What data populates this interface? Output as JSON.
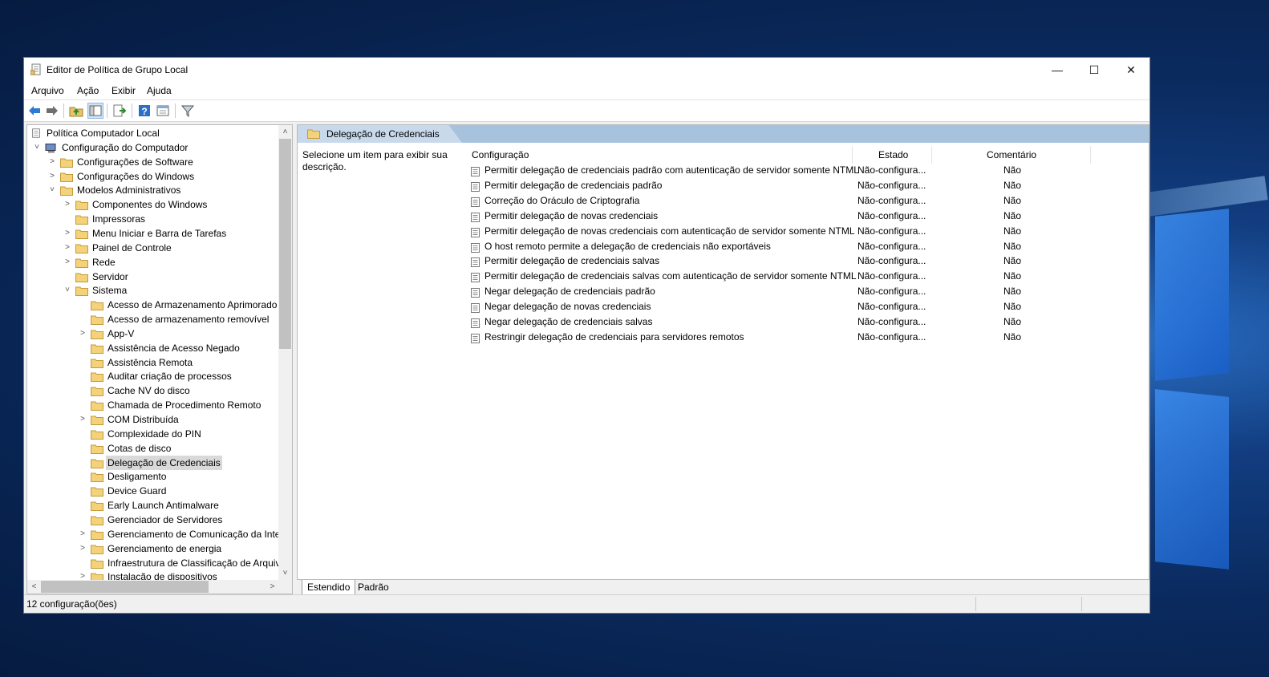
{
  "window": {
    "title": "Editor de Política de Grupo Local"
  },
  "menu": [
    "Arquivo",
    "Ação",
    "Exibir",
    "Ajuda"
  ],
  "toolbar_icons": [
    "back-arrow-icon",
    "forward-arrow-icon",
    "up-folder-icon",
    "show-hide-tree-icon",
    "export-list-icon",
    "help-icon",
    "properties-icon",
    "filter-icon"
  ],
  "tree": {
    "root": "Política Computador Local",
    "items": [
      {
        "label": "Configuração do Computador",
        "level": 1,
        "expander": "open",
        "icon": "computer"
      },
      {
        "label": "Configurações de Software",
        "level": 2,
        "expander": "closed"
      },
      {
        "label": "Configurações do Windows",
        "level": 2,
        "expander": "closed"
      },
      {
        "label": "Modelos Administrativos",
        "level": 2,
        "expander": "open"
      },
      {
        "label": "Componentes do Windows",
        "level": 3,
        "expander": "closed"
      },
      {
        "label": "Impressoras",
        "level": 3,
        "expander": "none"
      },
      {
        "label": "Menu Iniciar e Barra de Tarefas",
        "level": 3,
        "expander": "closed"
      },
      {
        "label": "Painel de Controle",
        "level": 3,
        "expander": "closed"
      },
      {
        "label": "Rede",
        "level": 3,
        "expander": "closed"
      },
      {
        "label": "Servidor",
        "level": 3,
        "expander": "none"
      },
      {
        "label": "Sistema",
        "level": 3,
        "expander": "open"
      },
      {
        "label": "Acesso de Armazenamento Aprimorado",
        "level": 4,
        "expander": "none"
      },
      {
        "label": "Acesso de armazenamento removível",
        "level": 4,
        "expander": "none"
      },
      {
        "label": "App-V",
        "level": 4,
        "expander": "closed"
      },
      {
        "label": "Assistência de Acesso Negado",
        "level": 4,
        "expander": "none"
      },
      {
        "label": "Assistência Remota",
        "level": 4,
        "expander": "none"
      },
      {
        "label": "Auditar criação de processos",
        "level": 4,
        "expander": "none"
      },
      {
        "label": "Cache NV do disco",
        "level": 4,
        "expander": "none"
      },
      {
        "label": "Chamada de Procedimento Remoto",
        "level": 4,
        "expander": "none"
      },
      {
        "label": "COM Distribuída",
        "level": 4,
        "expander": "closed"
      },
      {
        "label": "Complexidade do PIN",
        "level": 4,
        "expander": "none"
      },
      {
        "label": "Cotas de disco",
        "level": 4,
        "expander": "none"
      },
      {
        "label": "Delegação de Credenciais",
        "level": 4,
        "expander": "none",
        "selected": true
      },
      {
        "label": "Desligamento",
        "level": 4,
        "expander": "none"
      },
      {
        "label": "Device Guard",
        "level": 4,
        "expander": "none"
      },
      {
        "label": "Early Launch Antimalware",
        "level": 4,
        "expander": "none"
      },
      {
        "label": "Gerenciador de Servidores",
        "level": 4,
        "expander": "none"
      },
      {
        "label": "Gerenciamento de Comunicação da Internet",
        "level": 4,
        "expander": "closed"
      },
      {
        "label": "Gerenciamento de energia",
        "level": 4,
        "expander": "closed"
      },
      {
        "label": "Infraestrutura de Classificação de Arquivos",
        "level": 4,
        "expander": "none"
      },
      {
        "label": "Instalação de dispositivos",
        "level": 4,
        "expander": "closed"
      }
    ]
  },
  "right": {
    "header": "Delegação de Credenciais",
    "description": "Selecione um item para exibir sua descrição.",
    "columns": {
      "setting": "Configuração",
      "state": "Estado",
      "comment": "Comentário"
    },
    "rows": [
      {
        "name": "Permitir delegação de credenciais padrão com autenticação de servidor somente NTML",
        "state": "Não-configura...",
        "comment": "Não"
      },
      {
        "name": "Permitir delegação de credenciais padrão",
        "state": "Não-configura...",
        "comment": "Não"
      },
      {
        "name": "Correção do Oráculo de Criptografia",
        "state": "Não-configura...",
        "comment": "Não"
      },
      {
        "name": "Permitir delegação de novas credenciais",
        "state": "Não-configura...",
        "comment": "Não"
      },
      {
        "name": "Permitir delegação de novas credenciais com autenticação de servidor somente NTML",
        "state": "Não-configura...",
        "comment": "Não"
      },
      {
        "name": "O host remoto permite a delegação de credenciais não exportáveis",
        "state": "Não-configura...",
        "comment": "Não"
      },
      {
        "name": "Permitir delegação de credenciais salvas",
        "state": "Não-configura...",
        "comment": "Não"
      },
      {
        "name": "Permitir delegação de credenciais salvas com autenticação de servidor somente NTML",
        "state": "Não-configura...",
        "comment": "Não"
      },
      {
        "name": "Negar delegação de credenciais padrão",
        "state": "Não-configura...",
        "comment": "Não"
      },
      {
        "name": "Negar delegação de novas credenciais",
        "state": "Não-configura...",
        "comment": "Não"
      },
      {
        "name": "Negar delegação de credenciais salvas",
        "state": "Não-configura...",
        "comment": "Não"
      },
      {
        "name": "Restringir delegação de credenciais para servidores remotos",
        "state": "Não-configura...",
        "comment": "Não"
      }
    ]
  },
  "tabs": [
    "Estendido",
    "Padrão"
  ],
  "status": "12 configuração(ões)"
}
